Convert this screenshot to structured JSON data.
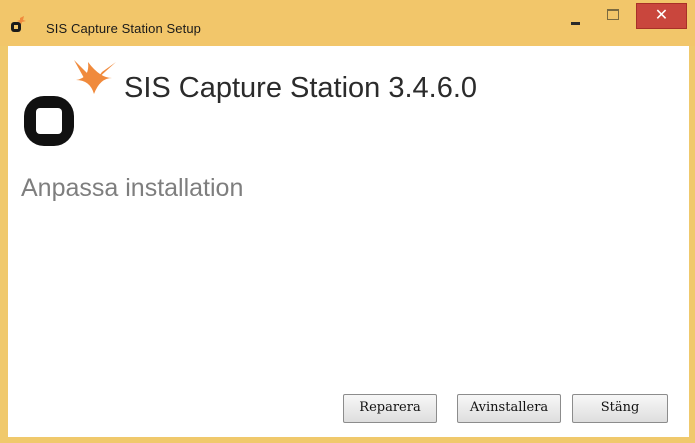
{
  "window": {
    "title": "SIS Capture Station Setup",
    "close_glyph": "✕",
    "colors": {
      "frame": "#f2c66a",
      "close": "#c9463d",
      "logo_accent": "#f08a3c"
    }
  },
  "content": {
    "product_title": "SIS Capture Station 3.4.6.0",
    "subtitle": "Anpassa installation"
  },
  "buttons": {
    "repair": "Reparera",
    "uninstall": "Avinstallera",
    "close": "Stäng"
  },
  "icons": {
    "app": "sis-logo-icon",
    "logo": "sis-logo-icon",
    "minimize": "minimize-icon",
    "maximize": "maximize-icon",
    "close": "close-icon"
  }
}
